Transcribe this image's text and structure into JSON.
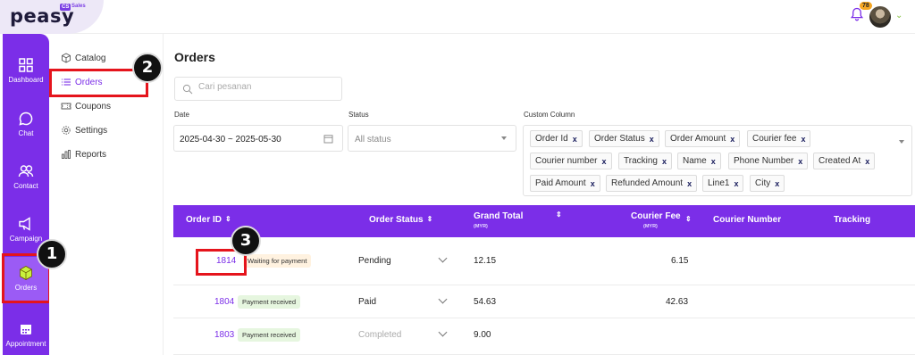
{
  "app": {
    "logo": "peasy",
    "logo_badge": "Sales",
    "logo_badge_prefix": "CS",
    "notification_count": "78"
  },
  "sidebar": {
    "items": [
      {
        "label": "Dashboard",
        "icon": "grid-icon"
      },
      {
        "label": "Chat",
        "icon": "chat-icon"
      },
      {
        "label": "Contact",
        "icon": "users-icon"
      },
      {
        "label": "Campaign",
        "icon": "megaphone-icon"
      },
      {
        "label": "Orders",
        "icon": "box-icon",
        "active": true
      },
      {
        "label": "Appointment",
        "icon": "calendar-icon"
      }
    ]
  },
  "submenu": {
    "items": [
      {
        "label": "Catalog",
        "icon": "cube-icon"
      },
      {
        "label": "Orders",
        "icon": "list-icon",
        "active": true
      },
      {
        "label": "Coupons",
        "icon": "ticket-icon"
      },
      {
        "label": "Settings",
        "icon": "gear-icon"
      },
      {
        "label": "Reports",
        "icon": "bar-chart-icon"
      }
    ]
  },
  "callouts": [
    "1",
    "2",
    "3"
  ],
  "main": {
    "title": "Orders",
    "search_placeholder": "Cari pesanan",
    "filters": {
      "date_label": "Date",
      "date_value": "2025-04-30 ~ 2025-05-30",
      "status_label": "Status",
      "status_value": "All status",
      "custom_label": "Custom Column",
      "custom_chips": [
        "Order Id",
        "Order Status",
        "Order Amount",
        "Courier fee",
        "Courier number",
        "Tracking",
        "Name",
        "Phone Number",
        "Created At",
        "Paid Amount",
        "Refunded Amount",
        "Line1",
        "City"
      ],
      "chip_remove": "x"
    },
    "table": {
      "headers": {
        "order_id": "Order ID",
        "order_status": "Order Status",
        "grand_total": "Grand Total",
        "grand_total_unit": "(MYR)",
        "courier_fee": "Courier Fee",
        "courier_fee_unit": "(MYR)",
        "courier_number": "Courier Number",
        "tracking": "Tracking"
      },
      "rows": [
        {
          "id": "1814",
          "payment": "Waiting for payment",
          "status": "Pending",
          "total": "12.15",
          "courier_fee": "6.15"
        },
        {
          "id": "1804",
          "payment": "Payment received",
          "status": "Paid",
          "total": "54.63",
          "courier_fee": "42.63"
        },
        {
          "id": "1803",
          "payment": "Payment received",
          "status": "Completed",
          "total": "9.00",
          "courier_fee": ""
        }
      ]
    }
  },
  "colors": {
    "brand": "#7b2ee8",
    "highlight": "#e5141c",
    "waiting_badge": "#fff2e0",
    "paid_badge": "#e6f6df"
  }
}
